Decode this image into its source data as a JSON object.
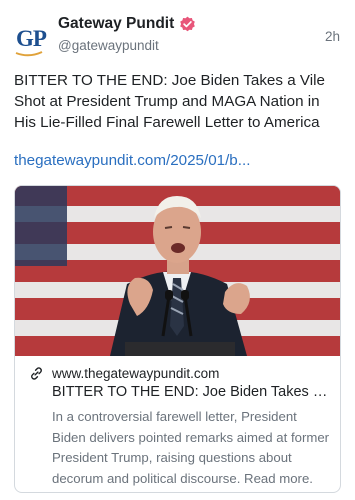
{
  "author": {
    "avatar_text": "GP",
    "display_name": "Gateway Pundit",
    "handle": "@gatewaypundit",
    "verified_icon": "verified-badge-icon",
    "avatar_color": "#1d4f8f"
  },
  "post": {
    "time_ago": "2h",
    "text": "BITTER TO THE END: Joe Biden Takes a Vile Shot at President Trump and MAGA Nation in His Lie-Filled Final Farewell Letter to America",
    "link_text": "thegatewaypundit.com/2025/01/b...",
    "link_color": "#2a6fc0"
  },
  "card": {
    "domain": "www.thegatewaypundit.com",
    "title": "BITTER TO THE END: Joe Biden Takes a Vile Shot at President Trump and MAGA Nation in His Lie-Filled Final Farewell Letter to America",
    "description": "In a controversial farewell letter, President Biden delivers pointed remarks aimed at former President Trump, raising questions about decorum and political discourse. Read more.",
    "link_icon": "link-icon",
    "image_alt": "Joe Biden speaking at a podium in front of an American flag"
  }
}
